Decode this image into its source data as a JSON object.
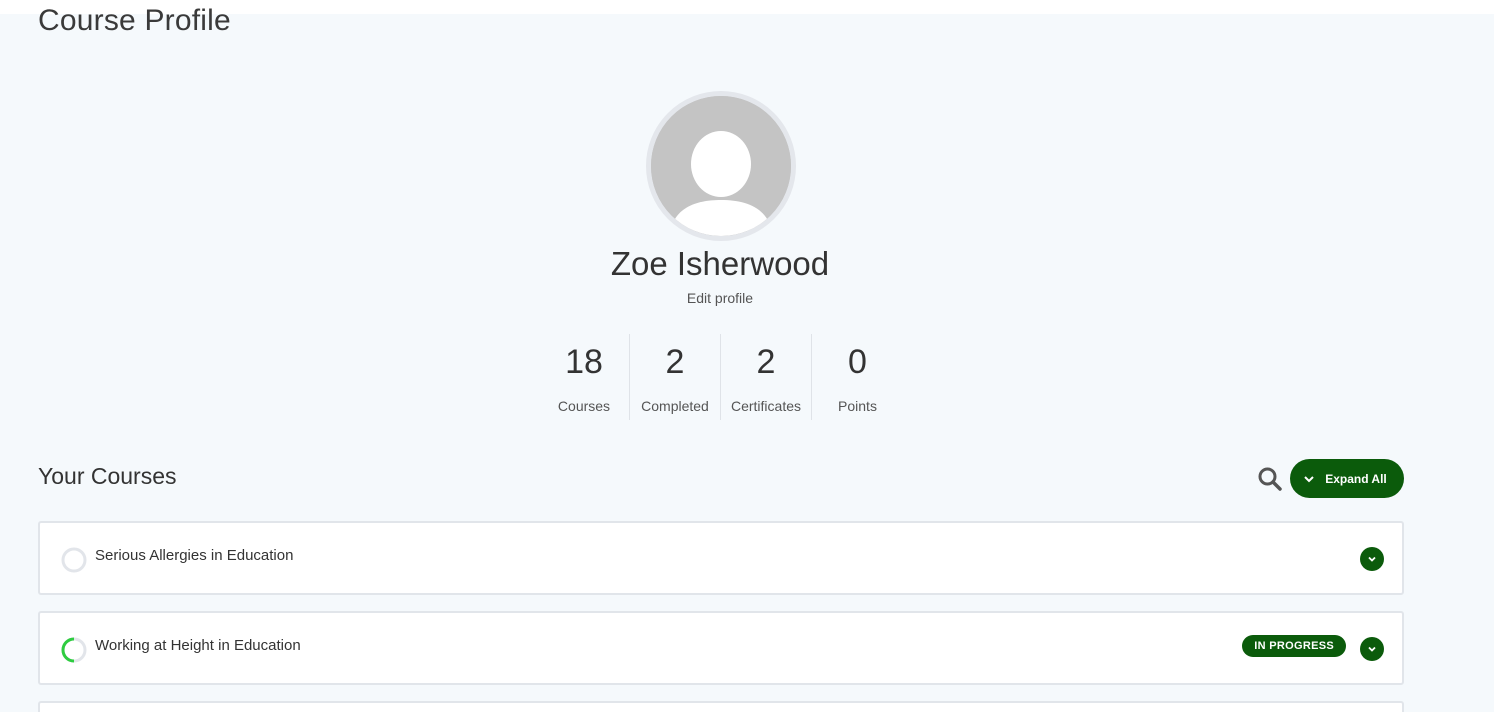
{
  "page": {
    "title": "Course Profile"
  },
  "profile": {
    "name": "Zoe Isherwood",
    "edit_label": "Edit profile",
    "avatar_icon": "user-avatar-placeholder"
  },
  "stats": [
    {
      "value": "18",
      "label": "Courses"
    },
    {
      "value": "2",
      "label": "Completed"
    },
    {
      "value": "2",
      "label": "Certificates"
    },
    {
      "value": "0",
      "label": "Points"
    }
  ],
  "courses_section": {
    "title": "Your Courses",
    "search_icon": "search-icon",
    "expand_all_label": "Expand All"
  },
  "courses": [
    {
      "title": "Serious Allergies in Education",
      "status": "",
      "progress": 0
    },
    {
      "title": "Working at Height in Education",
      "status": "IN PROGRESS",
      "progress": 0.3
    }
  ],
  "colors": {
    "accent": "#0b5b0b",
    "progress": "#2ecc40",
    "background": "#f5f9fc"
  }
}
